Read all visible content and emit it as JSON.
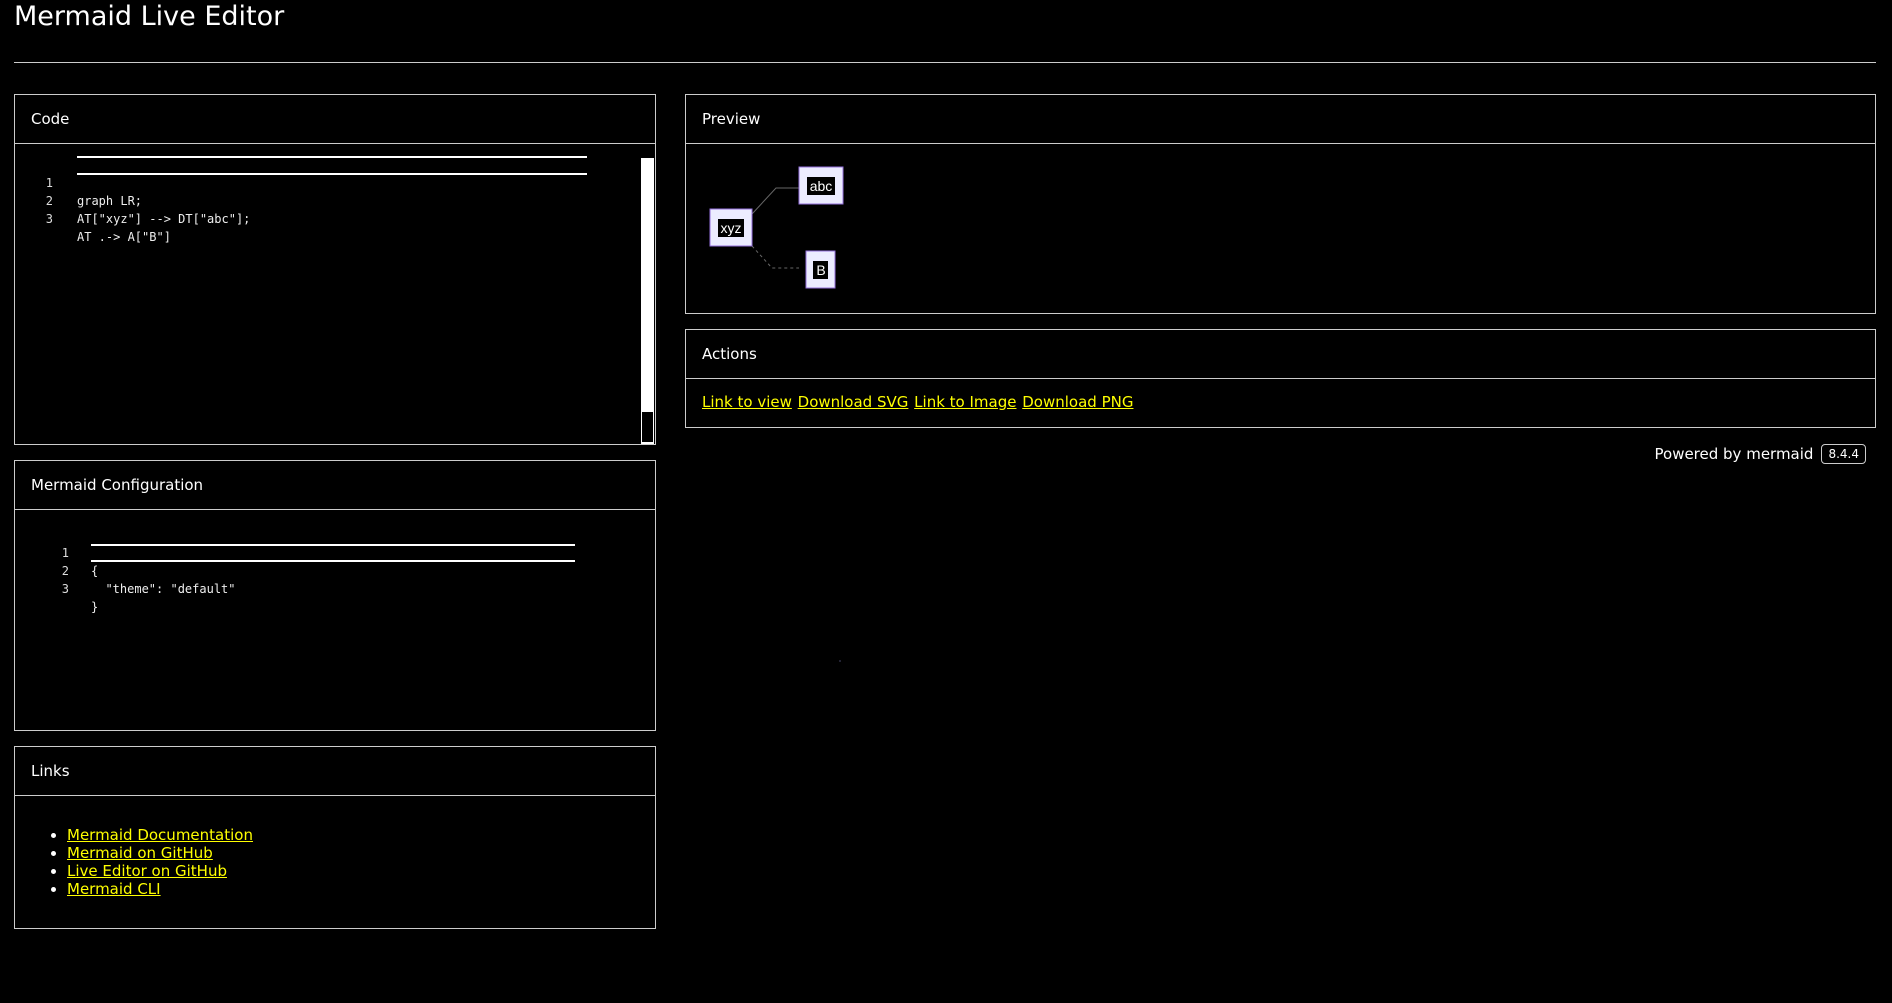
{
  "app": {
    "title": "Mermaid Live Editor"
  },
  "code_panel": {
    "header": "Code",
    "lines": [
      {
        "num": "1",
        "text": "graph LR;"
      },
      {
        "num": "2",
        "text": "AT[\"xyz\"] --> DT[\"abc\"];"
      },
      {
        "num": "3",
        "text": "AT .-> A[\"B\"]"
      }
    ]
  },
  "config_panel": {
    "header": "Mermaid Configuration",
    "lines": [
      {
        "num": "1",
        "text": "{"
      },
      {
        "num": "2",
        "text": "  \"theme\": \"default\""
      },
      {
        "num": "3",
        "text": "}"
      }
    ]
  },
  "links_panel": {
    "header": "Links",
    "items": [
      "Mermaid Documentation",
      "Mermaid on GitHub",
      "Live Editor on GitHub",
      "Mermaid CLI"
    ]
  },
  "preview_panel": {
    "header": "Preview",
    "nodes": {
      "xyz": "xyz",
      "abc": "abc",
      "b": "B"
    }
  },
  "actions_panel": {
    "header": "Actions",
    "link_to_view": "Link to view",
    "download_svg": "Download SVG",
    "link_to_image": "Link to Image",
    "download_png": "Download PNG"
  },
  "footer": {
    "powered_by": "Powered by mermaid",
    "version": "8.4.4"
  },
  "colors": {
    "background": "#000000",
    "link": "#ffff00",
    "node_fill": "#ececff",
    "node_stroke": "#9370db",
    "border": "#cccccc"
  }
}
